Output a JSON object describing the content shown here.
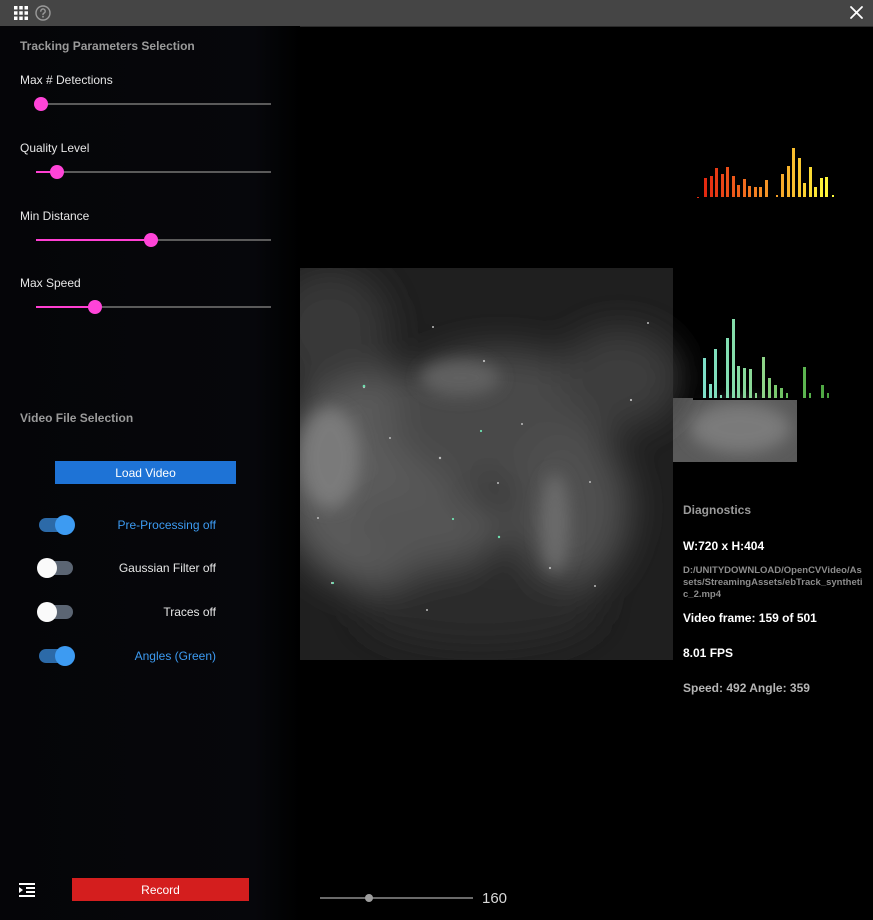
{
  "titlebar": {
    "apps_icon": "grid-icon",
    "help_icon": "help-icon",
    "close_icon": "close-icon"
  },
  "tracking": {
    "title": "Tracking Parameters Selection",
    "sliders": [
      {
        "label": "Max # Detections",
        "value_fraction": 0.02
      },
      {
        "label": "Quality Level",
        "value_fraction": 0.09
      },
      {
        "label": "Min Distance",
        "value_fraction": 0.49
      },
      {
        "label": "Max Speed",
        "value_fraction": 0.25
      }
    ]
  },
  "video_file": {
    "title": "Video File Selection",
    "load_button": "Load Video",
    "toggles": [
      {
        "label": "Pre-Processing off",
        "on": true
      },
      {
        "label": "Gaussian Filter off",
        "on": false
      },
      {
        "label": "Traces off",
        "on": false
      },
      {
        "label": "Angles (Green)",
        "on": true
      }
    ]
  },
  "diagnostics": {
    "title": "Diagnostics",
    "dimensions": "W:720 x H:404",
    "path": "D:/UNITYDOWNLOAD/OpenCVVideo/Assets/StreamingAssets/ebTrack_synthetic_2.mp4",
    "frame": "Video frame: 159 of 501",
    "fps": "8.01 FPS",
    "speed_angle": "Speed: 492 Angle: 359"
  },
  "bottom": {
    "menu_icon": "indent-menu-icon",
    "record_button": "Record",
    "slider_value": "160",
    "slider_fraction": 0.32
  },
  "colors": {
    "accent_pink": "#ff44d8",
    "accent_blue": "#3d9bf2",
    "button_blue": "#1e73d6",
    "record_red": "#d41e1e"
  }
}
